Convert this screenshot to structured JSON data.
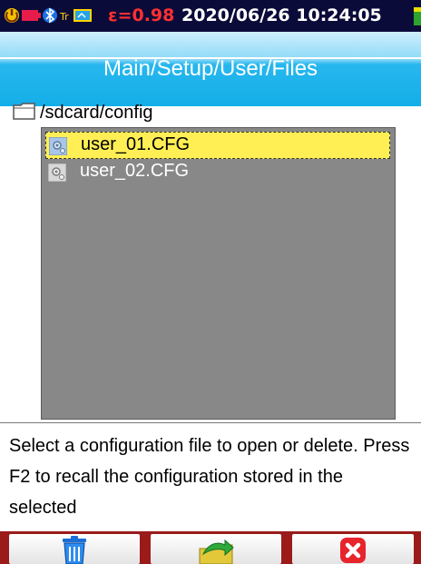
{
  "status_bar": {
    "epsilon": "ε=0.98",
    "datetime": "2020/06/26 10:24:05",
    "icons": [
      "power-icon",
      "battery-icon",
      "bluetooth-icon",
      "tf-card-icon",
      "sd-card-icon",
      "level-icon"
    ]
  },
  "header": {
    "title": "Main/Setup/User/Files"
  },
  "path": {
    "folder_icon": "folder-icon",
    "text": "/sdcard/config"
  },
  "files": [
    {
      "name": "user_01.CFG",
      "icon": "config-file-icon",
      "selected": true
    },
    {
      "name": "user_02.CFG",
      "icon": "config-file-icon",
      "selected": false
    }
  ],
  "help": {
    "text": "Select a configuration file to open or delete. Press F2 to recall the configuration stored in the selected"
  },
  "function_keys": [
    {
      "name": "f1",
      "icon": "trash-icon"
    },
    {
      "name": "f2",
      "icon": "recall-arrow-icon"
    },
    {
      "name": "f3",
      "icon": "close-icon"
    }
  ],
  "colors": {
    "status_bg": "#0b0b3a",
    "epsilon": "#ff3030",
    "title_bg": "#14aee8",
    "list_bg": "#888888",
    "selection": "#ffef55",
    "fkey_bar": "#9b1b1b"
  }
}
